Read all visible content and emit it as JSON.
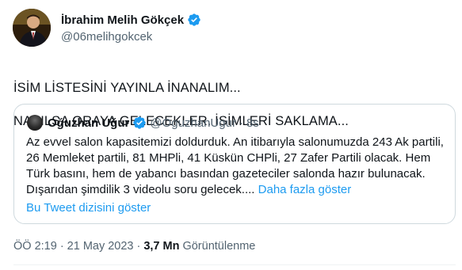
{
  "author": {
    "name": "İbrahim Melih Gökçek",
    "handle": "@06melihgokcek",
    "verified": true
  },
  "tweet": {
    "line1": "İSİM LİSTESİNİ YAYINLA İNANALIM...",
    "line2": "NASILSA ORAYA GELECEKLER. İSİMLERİ SAKLAMA..."
  },
  "quote": {
    "name": "Oğuzhan Uğur",
    "handle": "@OguzhanUgur",
    "separator": "·",
    "time": "8s",
    "verified": true,
    "text": "Az evvel salon kapasitemizi doldurduk. An itibarıyla salonumuzda 243 Ak partili, 26 Memleket partili, 81 MHPli, 41 Küskün CHPli, 27 Zafer Partili olacak. Hem Türk basını, hem de yabancı basından gazeteciler salonda hazır bulunacak. Dışarıdan şimdilik 3 videolu soru gelecek....",
    "show_more": "Daha fazla göster",
    "thread_link": "Bu Tweet dizisini göster"
  },
  "meta": {
    "time": "ÖÖ 2:19",
    "sep1": "·",
    "date": "21 May 2023",
    "sep2": "·",
    "views": "3,7 Mn",
    "views_label": "Görüntülenme"
  },
  "colors": {
    "accent": "#1d9bf0",
    "verified": "#1d9bf0",
    "secondary_text": "#536471",
    "border": "#cfd9de"
  },
  "icons": {
    "verified": "verified-badge-icon",
    "more": "more-options-icon"
  }
}
